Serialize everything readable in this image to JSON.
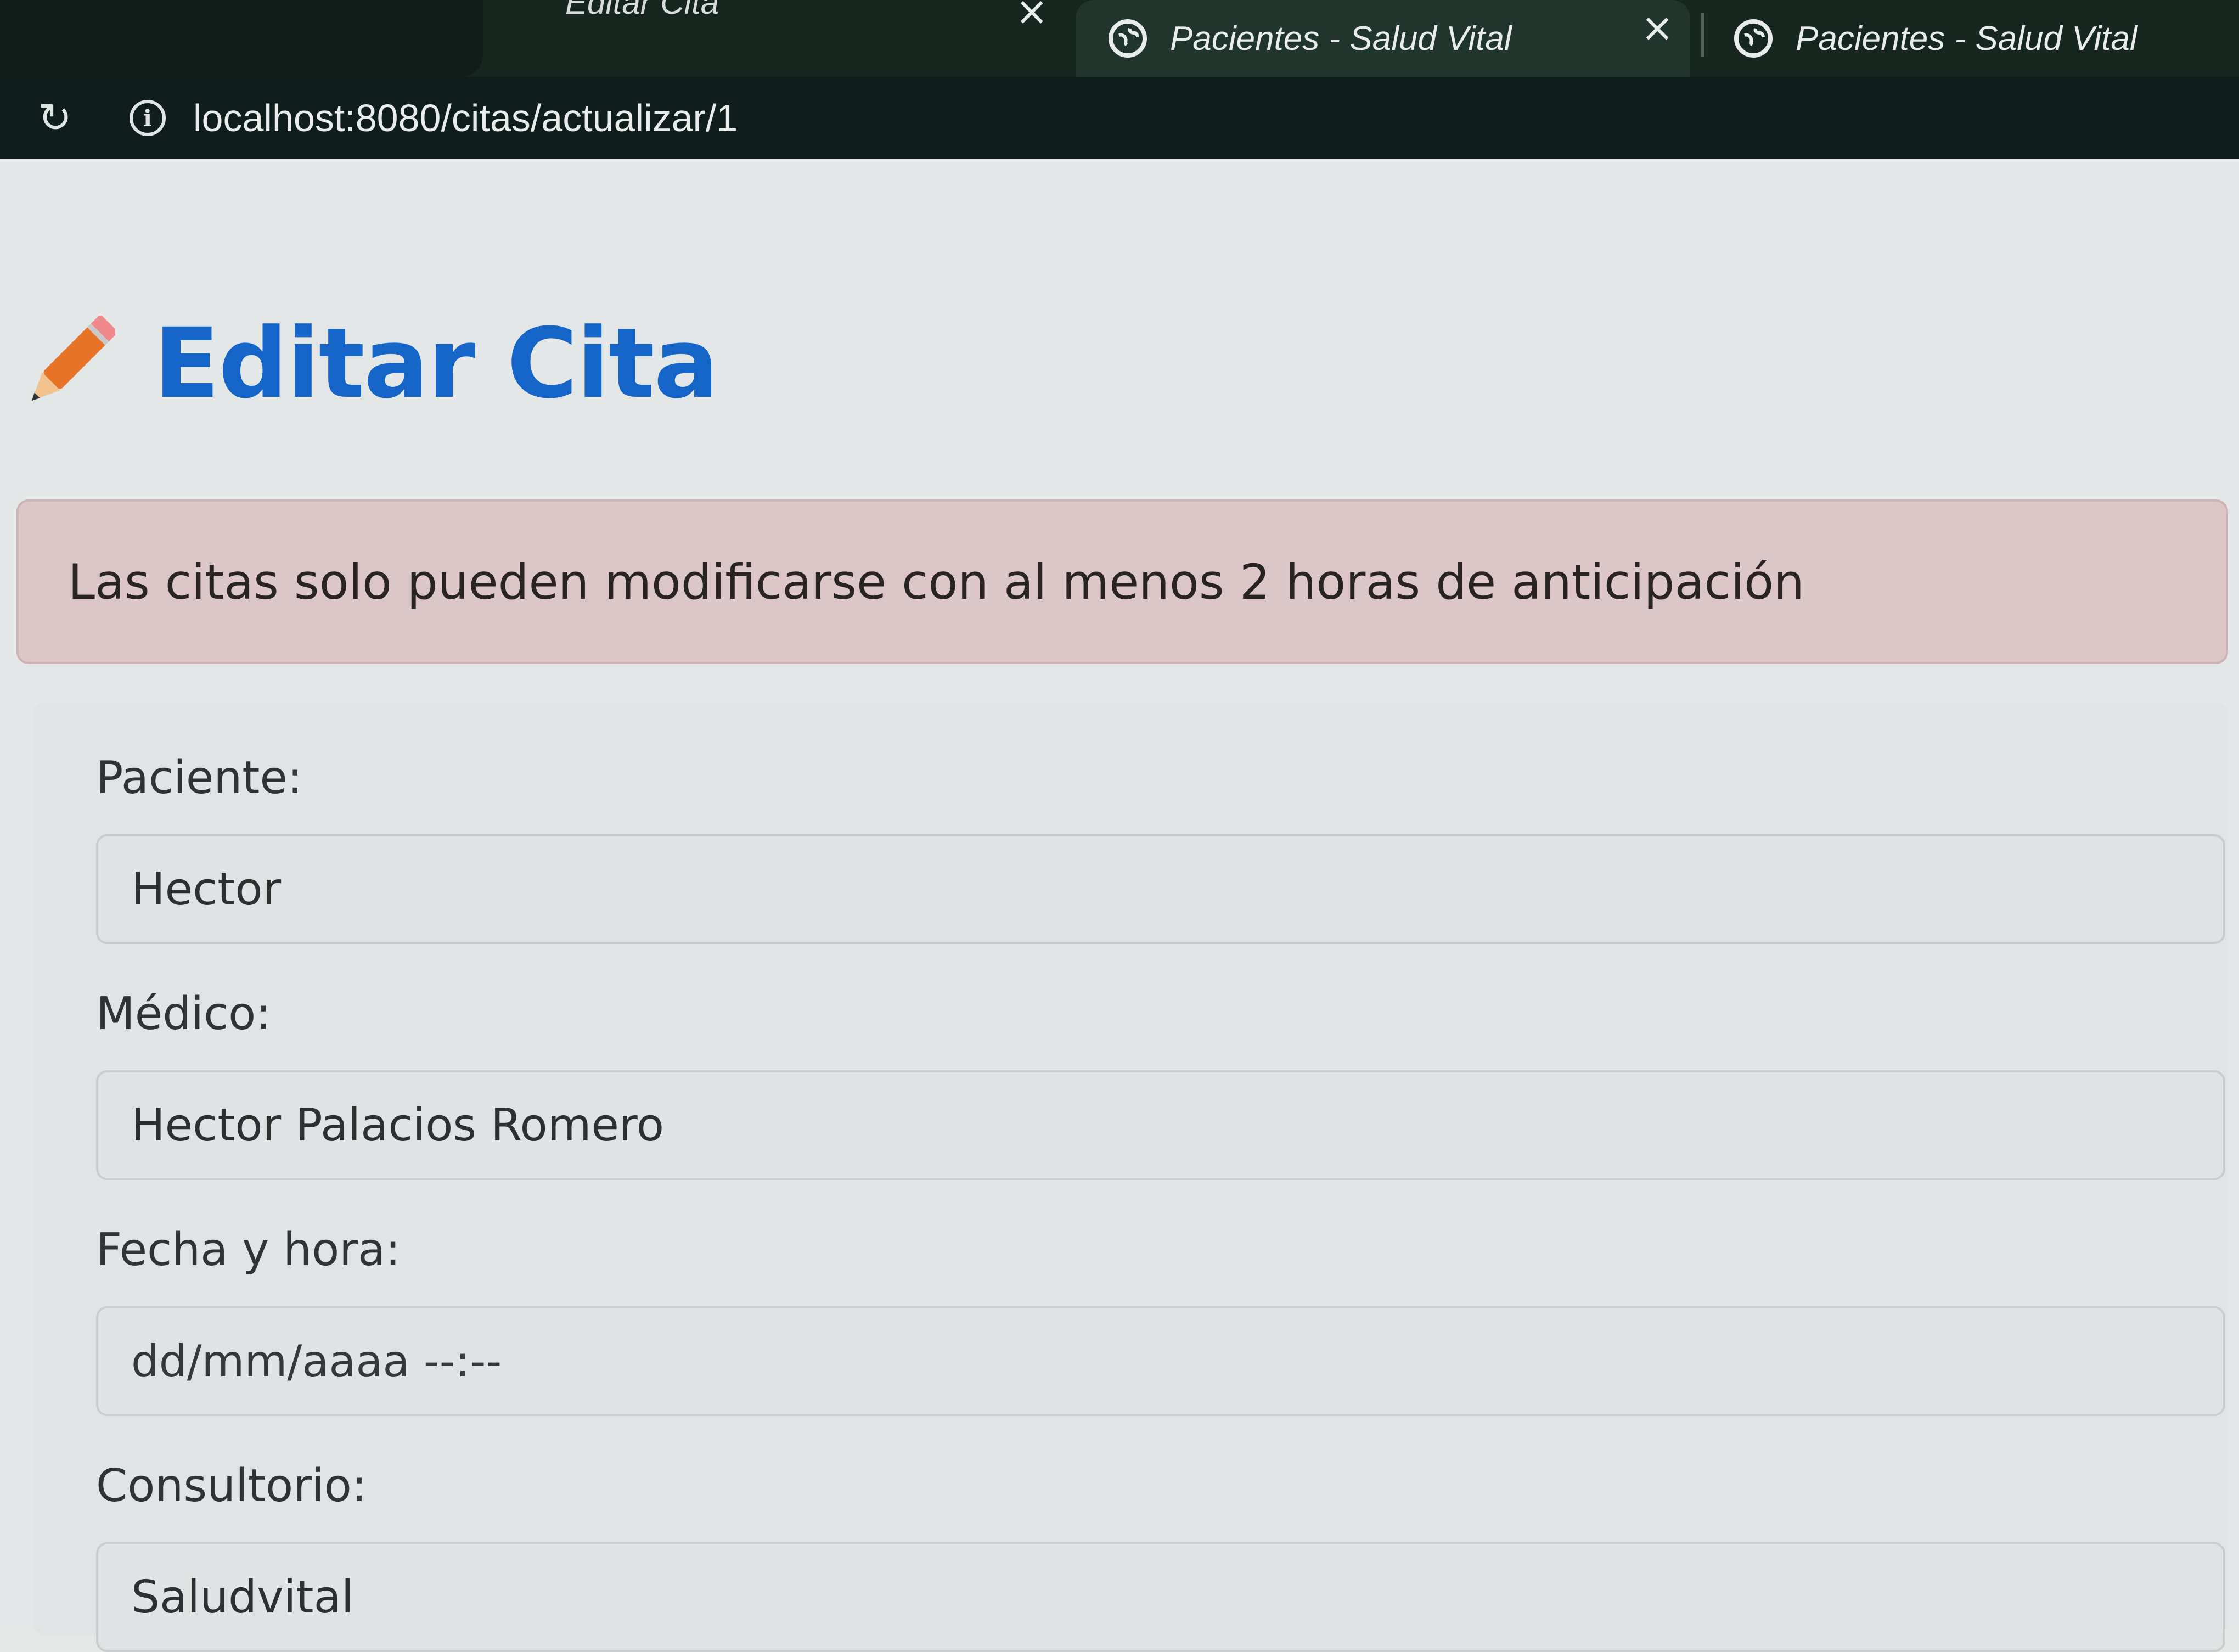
{
  "browser": {
    "tabs": [
      {
        "label": "Editar Cita",
        "active": false
      },
      {
        "label": "Pacientes - Salud Vital",
        "active": true
      },
      {
        "label": "Pacientes - Salud Vital",
        "active": false
      }
    ],
    "url": "localhost:8080/citas/actualizar/1"
  },
  "page": {
    "title": "Editar Cita",
    "alert": "Las citas solo pueden modificarse con al menos 2 horas de anticipación",
    "form": {
      "paciente_label": "Paciente:",
      "paciente_value": "Hector",
      "medico_label": "Médico:",
      "medico_value": "Hector Palacios Romero",
      "fecha_label": "Fecha y hora:",
      "fecha_placeholder": "dd/mm/aaaa --:--",
      "consultorio_label": "Consultorio:",
      "consultorio_value": "Saludvital"
    }
  },
  "colors": {
    "title": "#1565c9",
    "alert_bg": "#ddc6c7",
    "chrome_bg": "#16271f"
  },
  "icons": [
    "reload-icon",
    "info-icon",
    "globe-icon",
    "close-icon",
    "pencil-icon"
  ]
}
